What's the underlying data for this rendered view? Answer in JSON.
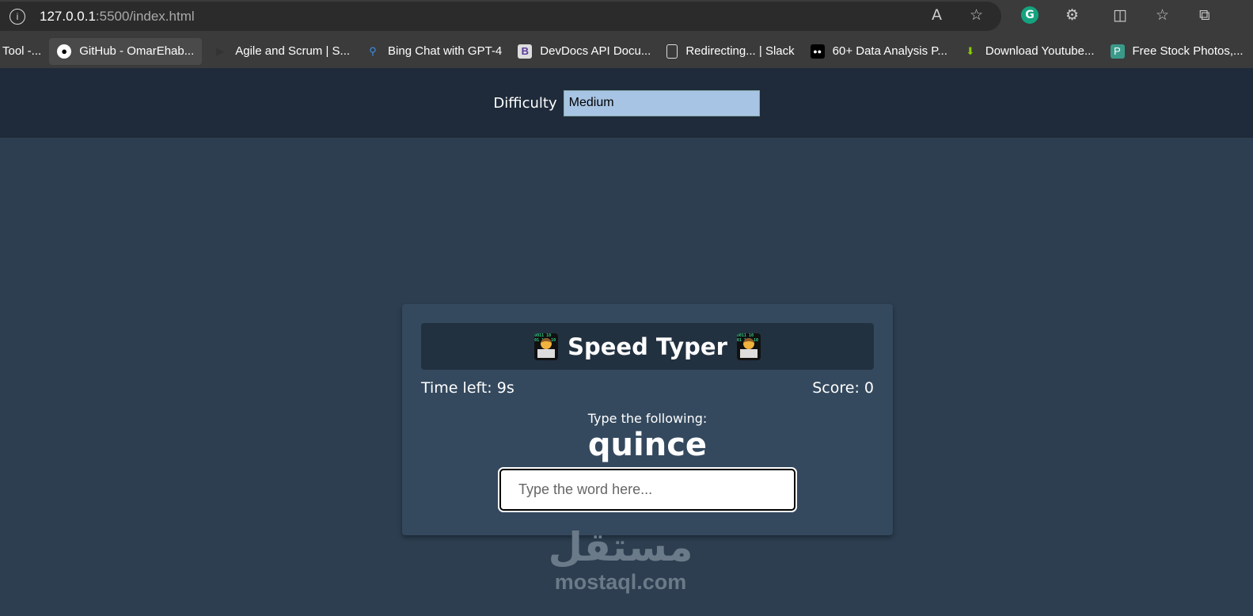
{
  "browser": {
    "url_host": "127.0.0.1",
    "url_rest": ":5500/index.html",
    "bookmarks": [
      {
        "label": "Tool -...",
        "icon": ""
      },
      {
        "label": "GitHub - OmarEhab...",
        "icon": "github-icon"
      },
      {
        "label": "Agile and Scrum | S...",
        "icon": "play-icon"
      },
      {
        "label": "Bing Chat with GPT-4",
        "icon": "search-icon"
      },
      {
        "label": "DevDocs API Docu...",
        "icon": "devdocs-icon"
      },
      {
        "label": "Redirecting... | Slack",
        "icon": "page-icon"
      },
      {
        "label": "60+ Data Analysis P...",
        "icon": "medium-icon"
      },
      {
        "label": "Download Youtube...",
        "icon": "download-icon"
      },
      {
        "label": "Free Stock Photos,...",
        "icon": "pexels-icon"
      }
    ]
  },
  "settings": {
    "difficulty_label": "Difficulty",
    "difficulty_value": "Medium"
  },
  "game": {
    "title": "Speed Typer",
    "time_left": "Time left: 9s",
    "score": "Score: 0",
    "prompt": "Type the following:",
    "word": "quince",
    "input_placeholder": "Type the word here..."
  },
  "watermark": {
    "arabic": "مستقل",
    "latin": "mostaql.com"
  }
}
